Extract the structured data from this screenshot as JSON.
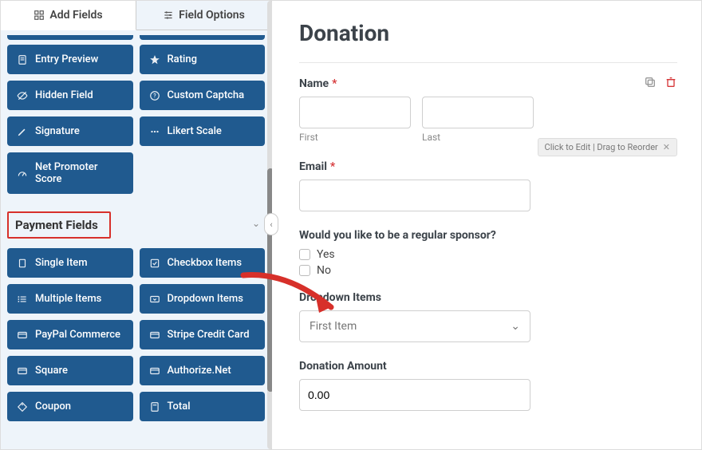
{
  "tabs": {
    "add_fields": "Add Fields",
    "field_options": "Field Options"
  },
  "fancy_fields": [
    {
      "icon": "doc",
      "label": "Entry Preview"
    },
    {
      "icon": "star",
      "label": "Rating"
    },
    {
      "icon": "eye-off",
      "label": "Hidden Field"
    },
    {
      "icon": "help",
      "label": "Custom Captcha"
    },
    {
      "icon": "pen",
      "label": "Signature"
    },
    {
      "icon": "dots",
      "label": "Likert Scale"
    },
    {
      "icon": "gauge",
      "label": "Net Promoter Score"
    }
  ],
  "section": {
    "title": "Payment Fields"
  },
  "payment_fields": [
    {
      "icon": "file",
      "label": "Single Item"
    },
    {
      "icon": "check-sq",
      "label": "Checkbox Items"
    },
    {
      "icon": "list",
      "label": "Multiple Items"
    },
    {
      "icon": "dropdown",
      "label": "Dropdown Items"
    },
    {
      "icon": "card",
      "label": "PayPal Commerce"
    },
    {
      "icon": "card",
      "label": "Stripe Credit Card"
    },
    {
      "icon": "card",
      "label": "Square"
    },
    {
      "icon": "card",
      "label": "Authorize.Net"
    },
    {
      "icon": "tag",
      "label": "Coupon"
    },
    {
      "icon": "calc",
      "label": "Total"
    }
  ],
  "form": {
    "title": "Donation",
    "name": {
      "label": "Name",
      "required": "*",
      "first_sub": "First",
      "last_sub": "Last"
    },
    "hint": "Click to Edit | Drag to Reorder",
    "email": {
      "label": "Email",
      "required": "*"
    },
    "sponsor": {
      "label": "Would you like to be a regular sponsor?",
      "opt_yes": "Yes",
      "opt_no": "No"
    },
    "dropdown": {
      "label": "Dropdown Items",
      "selected": "First Item"
    },
    "amount": {
      "label": "Donation Amount",
      "value": "0.00"
    }
  }
}
